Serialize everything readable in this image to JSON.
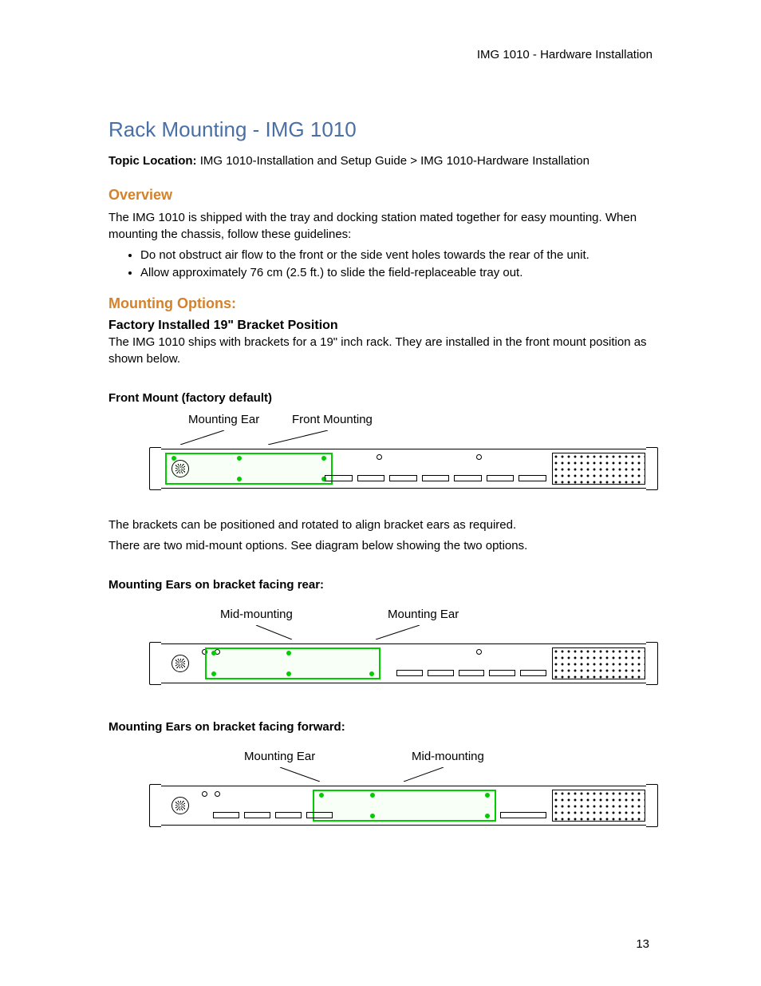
{
  "header": {
    "right_text": "IMG 1010 - Hardware Installation"
  },
  "title": "Rack Mounting - IMG 1010",
  "topic": {
    "label": "Topic Location:",
    "path": "IMG 1010-Installation and Setup Guide > IMG 1010-Hardware Installation"
  },
  "overview": {
    "heading": "Overview",
    "intro": "The IMG 1010 is shipped with the tray and docking station mated together for easy mounting. When mounting the chassis, follow these guidelines:",
    "bullets": [
      "Do not obstruct air flow to the front or the side vent holes towards the rear of the unit.",
      "Allow approximately 76 cm (2.5 ft.) to slide the field-replaceable tray out."
    ]
  },
  "mounting": {
    "heading": "Mounting Options:",
    "factory": {
      "heading": "Factory Installed 19\" Bracket Position",
      "text": "The IMG 1010 ships with brackets for a 19\" inch rack. They are installed in the front mount position as shown below."
    },
    "front_mount": {
      "caption": "Front Mount (factory default)",
      "label_left": "Mounting Ear",
      "label_right": "Front Mounting"
    },
    "note": {
      "p1": "The brackets can be positioned and rotated to align bracket ears as required.",
      "p2": "There are two mid-mount options. See diagram below showing the two options."
    },
    "rear": {
      "caption": "Mounting Ears on bracket facing rear:",
      "label_left": "Mid-mounting",
      "label_right": "Mounting Ear"
    },
    "forward": {
      "caption": "Mounting Ears on bracket facing forward:",
      "label_left": "Mounting Ear",
      "label_right": "Mid-mounting"
    }
  },
  "page_number": "13"
}
